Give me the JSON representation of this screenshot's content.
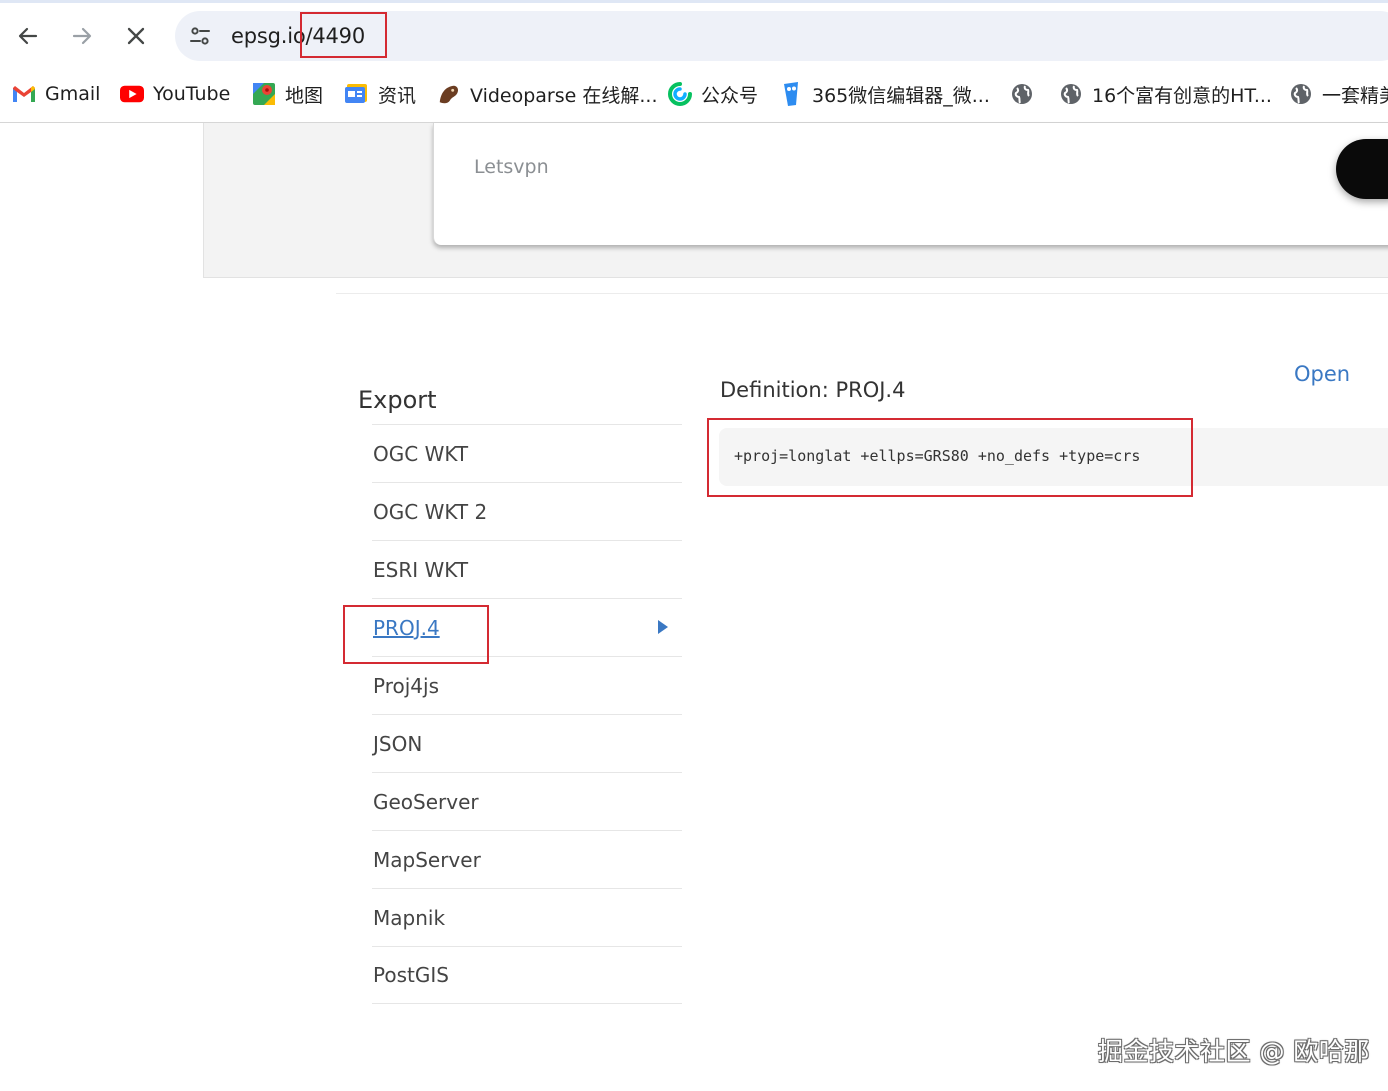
{
  "browser": {
    "url": {
      "host": "epsg.io",
      "path": "/4490"
    },
    "bookmarks": [
      {
        "label": "Gmail",
        "icon": "gmail-icon"
      },
      {
        "label": "YouTube",
        "icon": "youtube-icon"
      },
      {
        "label": "地图",
        "icon": "maps-icon"
      },
      {
        "label": "资讯",
        "icon": "news-icon"
      },
      {
        "label": "Videoparse 在线解...",
        "icon": "videoparse-icon"
      },
      {
        "label": "公众号",
        "icon": "wechat-mp-icon"
      },
      {
        "label": "365微信编辑器_微...",
        "icon": "365-editor-icon"
      },
      {
        "label": "",
        "icon": "globe-icon"
      },
      {
        "label": "16个富有创意的HT...",
        "icon": "globe-icon"
      },
      {
        "label": "一套精美",
        "icon": "globe-icon"
      }
    ]
  },
  "page": {
    "card_input_text": "Letsvpn",
    "export": {
      "heading": "Export",
      "items": [
        {
          "label": "OGC WKT",
          "active": false
        },
        {
          "label": "OGC WKT 2",
          "active": false
        },
        {
          "label": "ESRI WKT",
          "active": false
        },
        {
          "label": "PROJ.4",
          "active": true
        },
        {
          "label": "Proj4js",
          "active": false
        },
        {
          "label": "JSON",
          "active": false
        },
        {
          "label": "GeoServer",
          "active": false
        },
        {
          "label": "MapServer",
          "active": false
        },
        {
          "label": "Mapnik",
          "active": false
        },
        {
          "label": "PostGIS",
          "active": false
        }
      ]
    },
    "definition": {
      "title": "Definition: PROJ.4",
      "open_label": "Open",
      "code": "+proj=longlat +ellps=GRS80 +no_defs +type=crs"
    }
  },
  "watermark": "掘金技术社区 @ 欧哈那",
  "colors": {
    "link": "#3a78c3",
    "annotation": "#d42a32",
    "omnibox": "#eef1f8"
  }
}
